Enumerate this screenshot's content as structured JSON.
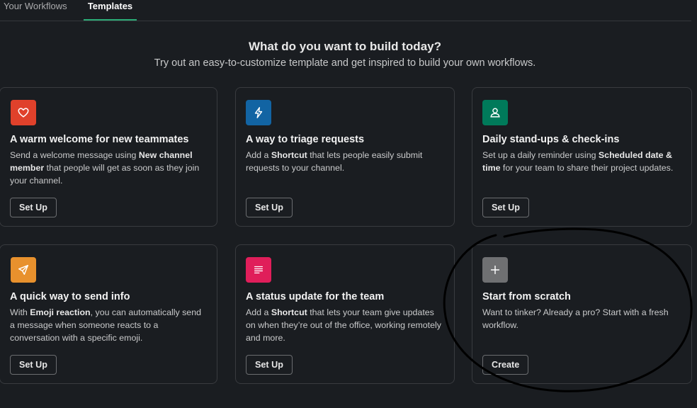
{
  "tabs": [
    {
      "label": "Your Workflows",
      "active": false
    },
    {
      "label": "Templates",
      "active": true
    }
  ],
  "heading": "What do you want to build today?",
  "subheading": "Try out an easy-to-customize template and get inspired to build your own workflows.",
  "cards": [
    {
      "icon": "heart-icon",
      "icon_color": "#e0412b",
      "title": "A warm welcome for new teammates",
      "desc": [
        "Send a welcome message using ",
        "New channel member",
        " that people will get as soon as they join your channel."
      ],
      "button": "Set Up"
    },
    {
      "icon": "lightning-icon",
      "icon_color": "#1264a3",
      "title": "A way to triage requests",
      "desc": [
        "Add a ",
        "Shortcut",
        " that lets people easily submit requests to your channel."
      ],
      "button": "Set Up"
    },
    {
      "icon": "person-icon",
      "icon_color": "#007a5a",
      "title": "Daily stand-ups & check-ins",
      "desc": [
        "Set up a daily reminder using ",
        "Scheduled date & time",
        " for your team to share their project updates."
      ],
      "button": "Set Up"
    },
    {
      "icon": "paper-plane-icon",
      "icon_color": "#e8912d",
      "title": "A quick way to send info",
      "desc": [
        "With ",
        "Emoji reaction",
        ", you can automatically send a message when someone reacts to a conversation with a specific emoji."
      ],
      "button": "Set Up"
    },
    {
      "icon": "list-icon",
      "icon_color": "#e01e5a",
      "title": "A status update for the team",
      "desc": [
        "Add a ",
        "Shortcut",
        " that lets your team give updates on when they’re out of the office, working remotely and more."
      ],
      "button": "Set Up"
    },
    {
      "icon": "plus-icon",
      "icon_color": "#6f7072",
      "title": "Start from scratch",
      "desc": [
        "Want to tinker? Already a pro? Start with a fresh workflow.",
        "",
        ""
      ],
      "button": "Create"
    }
  ],
  "colors": {
    "background": "#1a1d21",
    "active_tab_underline": "#2bac76",
    "annotation_stroke": "#000000"
  }
}
